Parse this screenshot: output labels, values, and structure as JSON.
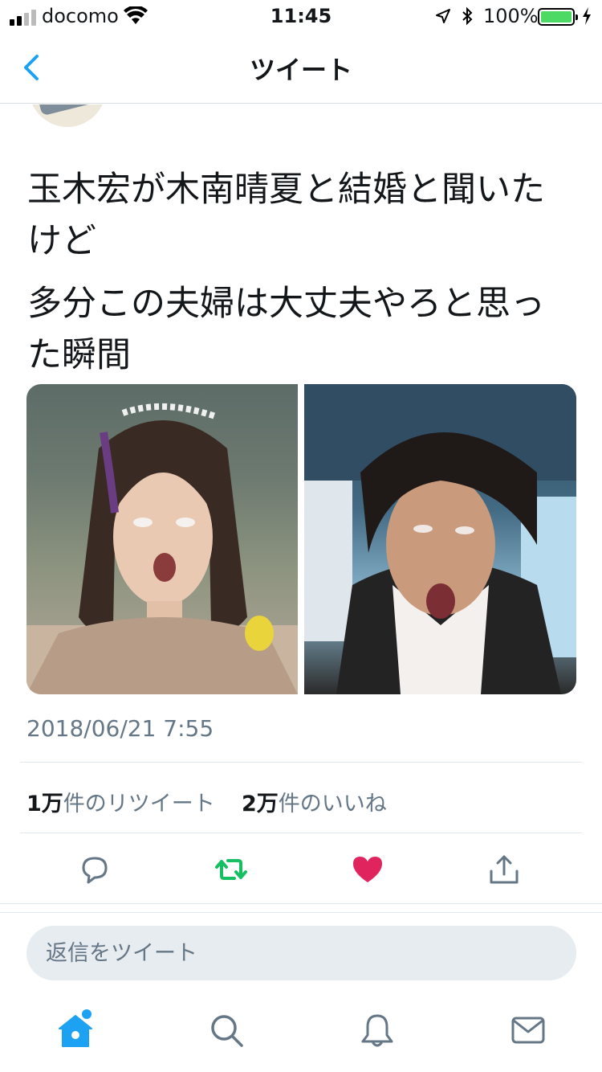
{
  "status_bar": {
    "carrier": "docomo",
    "time": "11:45",
    "battery": "100%"
  },
  "nav": {
    "title": "ツイート"
  },
  "tweet": {
    "text_lines": [
      "玉木宏が木南晴夏と結婚と聞いたけど",
      "多分この夫婦は大丈夫やろと思った瞬間"
    ],
    "timestamp": "2018/06/21 7:55",
    "retweets_count": "1万",
    "retweets_label": "件のリツイート",
    "likes_count": "2万",
    "likes_label": "件のいいね"
  },
  "reply": {
    "placeholder": "返信をツイート"
  },
  "colors": {
    "accent": "#1da1f2",
    "retweet": "#17bf63",
    "like": "#e0245e",
    "muted": "#657786"
  }
}
